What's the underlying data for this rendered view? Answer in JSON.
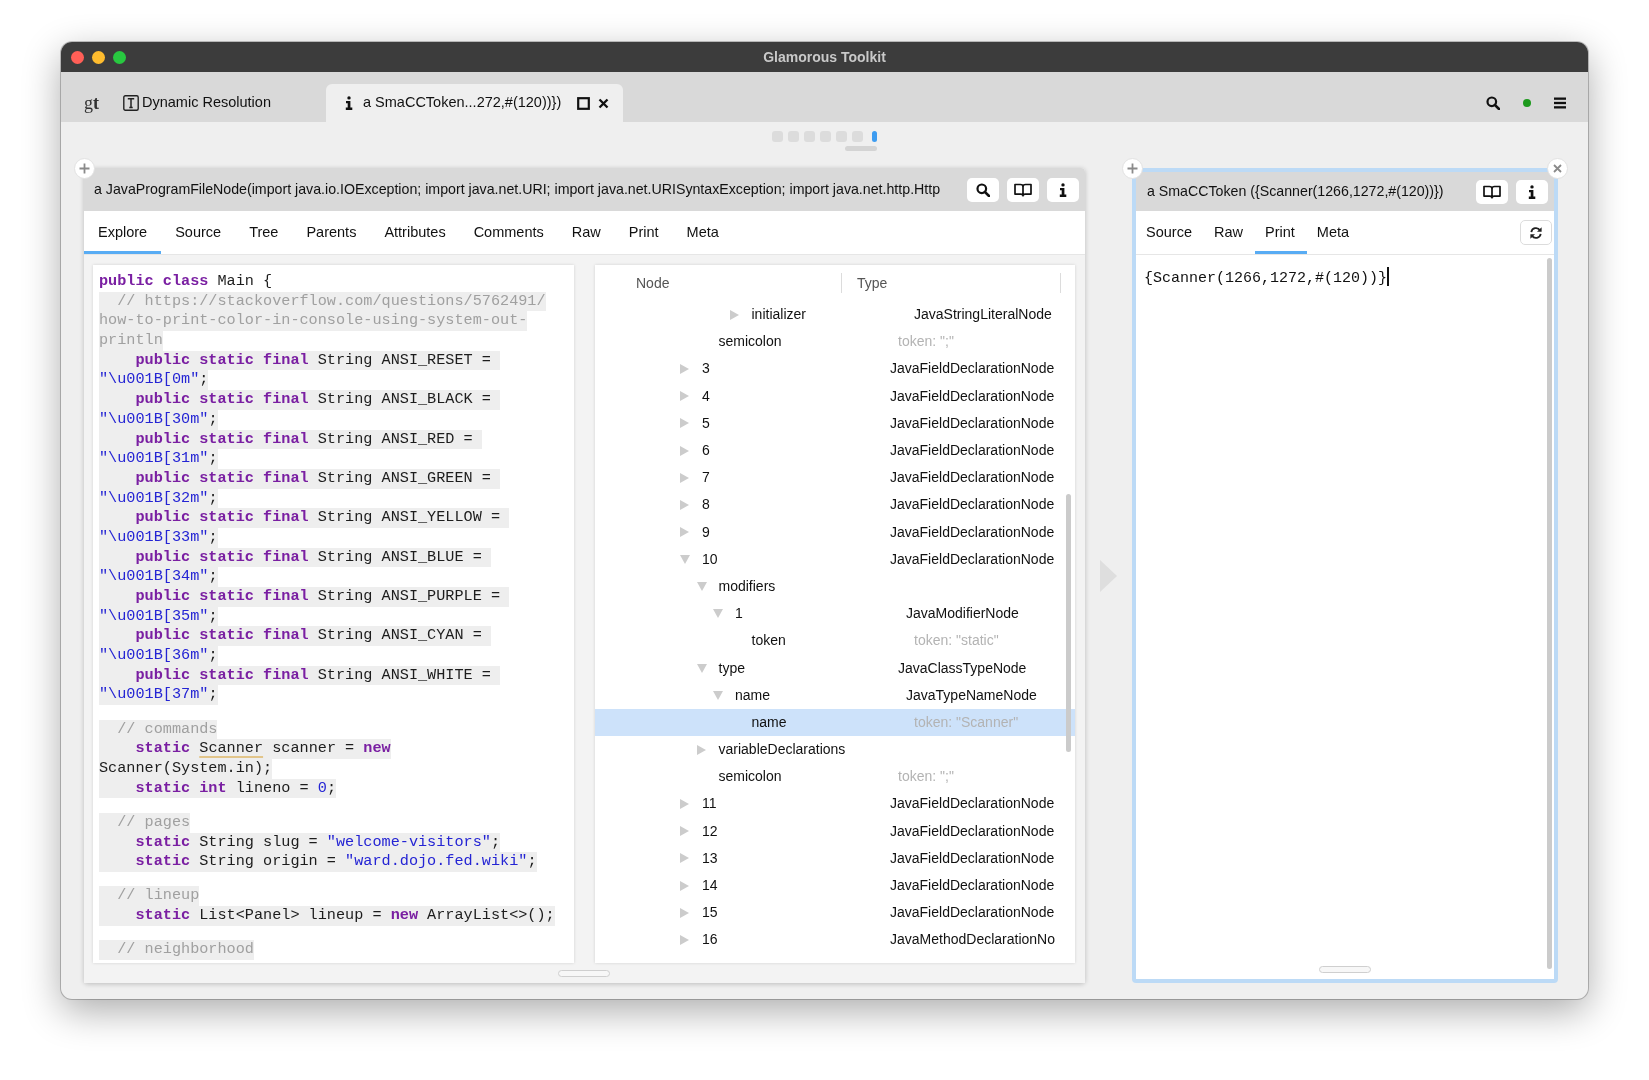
{
  "window": {
    "title": "Glamorous Toolkit"
  },
  "logo": "g**t**",
  "tabs": [
    {
      "kind": "page",
      "label": "Dynamic Resolution",
      "selected": false
    },
    {
      "kind": "inspector",
      "label": "a SmaCCToken...272,#(120))})",
      "selected": true
    }
  ],
  "pager": [
    {
      "selected": false
    },
    {
      "selected": false
    },
    {
      "selected": false
    },
    {
      "selected": false
    },
    {
      "selected": false
    },
    {
      "selected": false
    },
    {
      "selected": true
    }
  ],
  "panes": [
    {
      "kind": "explorer",
      "active": false,
      "closable": false,
      "title": "a JavaProgramFileNode(import java.io.IOException; import java.net.URI; import java.net.URISyntaxException; import java.net.http.Http",
      "actions": [
        {
          "kind": "search"
        },
        {
          "kind": "book"
        },
        {
          "kind": "info"
        }
      ],
      "views": [
        {
          "label": "Explore",
          "selected": true
        },
        {
          "label": "Source",
          "selected": false
        },
        {
          "label": "Tree",
          "selected": false
        },
        {
          "label": "Parents",
          "selected": false
        },
        {
          "label": "Attributes",
          "selected": false
        },
        {
          "label": "Comments",
          "selected": false
        },
        {
          "label": "Raw",
          "selected": false
        },
        {
          "label": "Print",
          "selected": false
        },
        {
          "label": "Meta",
          "selected": false
        }
      ],
      "code": {
        "blocks": [
          {
            "lines": [
              {
                "highlighted": false,
                "segments": [
                  {
                    "kind": "keyword",
                    "text": "public class"
                  },
                  {
                    "kind": "plain",
                    "text": " Main {"
                  }
                ]
              },
              {
                "highlighted": true,
                "segments": [
                  {
                    "kind": "comment",
                    "text": "  // https://stackoverflow.com/questions/5762491/"
                  }
                ]
              },
              {
                "highlighted": true,
                "segments": [
                  {
                    "kind": "comment",
                    "text": "how-to-print-color-in-console-using-system-out-"
                  }
                ]
              },
              {
                "highlighted": true,
                "segments": [
                  {
                    "kind": "comment",
                    "text": "println"
                  }
                ]
              },
              {
                "highlighted": true,
                "segments": [
                  {
                    "kind": "keyword",
                    "text": "    public static final"
                  },
                  {
                    "kind": "plain",
                    "text": " String ANSI_RESET = "
                  }
                ]
              },
              {
                "highlighted": true,
                "segments": [
                  {
                    "kind": "literal",
                    "text": "\"\\u001B[0m\""
                  },
                  {
                    "kind": "plain",
                    "text": ";"
                  }
                ]
              },
              {
                "highlighted": true,
                "segments": [
                  {
                    "kind": "keyword",
                    "text": "    public static final"
                  },
                  {
                    "kind": "plain",
                    "text": " String ANSI_BLACK = "
                  }
                ]
              },
              {
                "highlighted": true,
                "segments": [
                  {
                    "kind": "literal",
                    "text": "\"\\u001B[30m\""
                  },
                  {
                    "kind": "plain",
                    "text": ";"
                  }
                ]
              },
              {
                "highlighted": true,
                "segments": [
                  {
                    "kind": "keyword",
                    "text": "    public static final"
                  },
                  {
                    "kind": "plain",
                    "text": " String ANSI_RED = "
                  }
                ]
              },
              {
                "highlighted": true,
                "segments": [
                  {
                    "kind": "literal",
                    "text": "\"\\u001B[31m\""
                  },
                  {
                    "kind": "plain",
                    "text": ";"
                  }
                ]
              },
              {
                "highlighted": true,
                "segments": [
                  {
                    "kind": "keyword",
                    "text": "    public static final"
                  },
                  {
                    "kind": "plain",
                    "text": " String ANSI_GREEN = "
                  }
                ]
              },
              {
                "highlighted": true,
                "segments": [
                  {
                    "kind": "literal",
                    "text": "\"\\u001B[32m\""
                  },
                  {
                    "kind": "plain",
                    "text": ";"
                  }
                ]
              },
              {
                "highlighted": true,
                "segments": [
                  {
                    "kind": "keyword",
                    "text": "    public static final"
                  },
                  {
                    "kind": "plain",
                    "text": " String ANSI_YELLOW = "
                  }
                ]
              },
              {
                "highlighted": true,
                "segments": [
                  {
                    "kind": "literal",
                    "text": "\"\\u001B[33m\""
                  },
                  {
                    "kind": "plain",
                    "text": ";"
                  }
                ]
              },
              {
                "highlighted": true,
                "segments": [
                  {
                    "kind": "keyword",
                    "text": "    public static final"
                  },
                  {
                    "kind": "plain",
                    "text": " String ANSI_BLUE = "
                  }
                ]
              },
              {
                "highlighted": true,
                "segments": [
                  {
                    "kind": "literal",
                    "text": "\"\\u001B[34m\""
                  },
                  {
                    "kind": "plain",
                    "text": ";"
                  }
                ]
              },
              {
                "highlighted": true,
                "segments": [
                  {
                    "kind": "keyword",
                    "text": "    public static final"
                  },
                  {
                    "kind": "plain",
                    "text": " String ANSI_PURPLE = "
                  }
                ]
              },
              {
                "highlighted": true,
                "segments": [
                  {
                    "kind": "literal",
                    "text": "\"\\u001B[35m\""
                  },
                  {
                    "kind": "plain",
                    "text": ";"
                  }
                ]
              },
              {
                "highlighted": true,
                "segments": [
                  {
                    "kind": "keyword",
                    "text": "    public static final"
                  },
                  {
                    "kind": "plain",
                    "text": " String ANSI_CYAN = "
                  }
                ]
              },
              {
                "highlighted": true,
                "segments": [
                  {
                    "kind": "literal",
                    "text": "\"\\u001B[36m\""
                  },
                  {
                    "kind": "plain",
                    "text": ";"
                  }
                ]
              },
              {
                "highlighted": true,
                "segments": [
                  {
                    "kind": "keyword",
                    "text": "    public static final"
                  },
                  {
                    "kind": "plain",
                    "text": " String ANSI_WHITE = "
                  }
                ]
              },
              {
                "highlighted": true,
                "segments": [
                  {
                    "kind": "literal",
                    "text": "\"\\u001B[37m\""
                  },
                  {
                    "kind": "plain",
                    "text": ";"
                  }
                ]
              }
            ]
          },
          {
            "lines": [
              {
                "highlighted": true,
                "segments": [
                  {
                    "kind": "comment",
                    "text": "  // commands"
                  }
                ]
              },
              {
                "highlighted": true,
                "segments": [
                  {
                    "kind": "keyword",
                    "text": "    static "
                  },
                  {
                    "kind": "marked",
                    "text": "Scanner"
                  },
                  {
                    "kind": "plain",
                    "text": " scanner = "
                  },
                  {
                    "kind": "keyword",
                    "text": "new"
                  }
                ]
              },
              {
                "highlighted": true,
                "segments": [
                  {
                    "kind": "plain",
                    "text": "Scanner(System.in);"
                  }
                ]
              },
              {
                "highlighted": true,
                "segments": [
                  {
                    "kind": "keyword",
                    "text": "    static int"
                  },
                  {
                    "kind": "plain",
                    "text": " lineno = "
                  },
                  {
                    "kind": "literal",
                    "text": "0"
                  },
                  {
                    "kind": "plain",
                    "text": ";"
                  }
                ]
              }
            ]
          },
          {
            "lines": [
              {
                "highlighted": true,
                "segments": [
                  {
                    "kind": "comment",
                    "text": "  // pages"
                  }
                ]
              },
              {
                "highlighted": true,
                "segments": [
                  {
                    "kind": "keyword",
                    "text": "    static"
                  },
                  {
                    "kind": "plain",
                    "text": " String slug = "
                  },
                  {
                    "kind": "literal",
                    "text": "\"welcome-visitors\""
                  },
                  {
                    "kind": "plain",
                    "text": ";"
                  }
                ]
              },
              {
                "highlighted": true,
                "segments": [
                  {
                    "kind": "keyword",
                    "text": "    static"
                  },
                  {
                    "kind": "plain",
                    "text": " String origin = "
                  },
                  {
                    "kind": "literal",
                    "text": "\"ward.dojo.fed.wiki\""
                  },
                  {
                    "kind": "plain",
                    "text": ";"
                  }
                ]
              }
            ]
          },
          {
            "lines": [
              {
                "highlighted": true,
                "segments": [
                  {
                    "kind": "comment",
                    "text": "  // lineup"
                  }
                ]
              },
              {
                "highlighted": true,
                "segments": [
                  {
                    "kind": "keyword",
                    "text": "    static"
                  },
                  {
                    "kind": "plain",
                    "text": " List<Panel> lineup = "
                  },
                  {
                    "kind": "keyword",
                    "text": "new"
                  },
                  {
                    "kind": "plain",
                    "text": " ArrayList<>();"
                  }
                ]
              }
            ]
          },
          {
            "lines": [
              {
                "highlighted": true,
                "segments": [
                  {
                    "kind": "comment",
                    "text": "  // neighborhood"
                  }
                ]
              }
            ]
          }
        ]
      },
      "tree": {
        "columns": [
          "Node",
          "Type"
        ],
        "rows": [
          {
            "kind": "offscreen",
            "children": [
              {
                "kind": "offscreen",
                "children": [
                  {
                    "kind": "offscreen",
                    "children": [
                      {
                        "kind": "node",
                        "label": "initializer",
                        "type": "JavaStringLiteralNode",
                        "expanded": false,
                        "selected": false
                      }
                    ]
                  }
                ]
              },
              {
                "kind": "token",
                "label": "semicolon",
                "type": "token: \";\"",
                "selected": false
              }
            ]
          },
          {
            "kind": "node",
            "label": "3",
            "type": "JavaFieldDeclarationNode",
            "expanded": false,
            "selected": false
          },
          {
            "kind": "node",
            "label": "4",
            "type": "JavaFieldDeclarationNode",
            "expanded": false,
            "selected": false
          },
          {
            "kind": "node",
            "label": "5",
            "type": "JavaFieldDeclarationNode",
            "expanded": false,
            "selected": false
          },
          {
            "kind": "node",
            "label": "6",
            "type": "JavaFieldDeclarationNode",
            "expanded": false,
            "selected": false
          },
          {
            "kind": "node",
            "label": "7",
            "type": "JavaFieldDeclarationNode",
            "expanded": false,
            "selected": false
          },
          {
            "kind": "node",
            "label": "8",
            "type": "JavaFieldDeclarationNode",
            "expanded": false,
            "selected": false
          },
          {
            "kind": "node",
            "label": "9",
            "type": "JavaFieldDeclarationNode",
            "expanded": false,
            "selected": false
          },
          {
            "kind": "node",
            "label": "10",
            "type": "JavaFieldDeclarationNode",
            "expanded": true,
            "selected": false,
            "children": [
              {
                "kind": "list",
                "label": "modifiers",
                "expanded": true,
                "selected": false,
                "children": [
                  {
                    "kind": "node",
                    "label": "1",
                    "type": "JavaModifierNode",
                    "expanded": true,
                    "selected": false,
                    "children": [
                      {
                        "kind": "token",
                        "label": "token",
                        "type": "token: \"static\"",
                        "selected": false
                      }
                    ]
                  }
                ]
              },
              {
                "kind": "node",
                "label": "type",
                "type": "JavaClassTypeNode",
                "expanded": true,
                "selected": false,
                "children": [
                  {
                    "kind": "node",
                    "label": "name",
                    "type": "JavaTypeNameNode",
                    "expanded": true,
                    "selected": false,
                    "children": [
                      {
                        "kind": "token",
                        "label": "name",
                        "type": "token: \"Scanner\"",
                        "selected": true
                      }
                    ]
                  }
                ]
              },
              {
                "kind": "list",
                "label": "variableDeclarations",
                "expanded": false,
                "selected": false
              },
              {
                "kind": "token",
                "label": "semicolon",
                "type": "token: \";\"",
                "selected": false
              }
            ]
          },
          {
            "kind": "node",
            "label": "11",
            "type": "JavaFieldDeclarationNode",
            "expanded": false,
            "selected": false
          },
          {
            "kind": "node",
            "label": "12",
            "type": "JavaFieldDeclarationNode",
            "expanded": false,
            "selected": false
          },
          {
            "kind": "node",
            "label": "13",
            "type": "JavaFieldDeclarationNode",
            "expanded": false,
            "selected": false
          },
          {
            "kind": "node",
            "label": "14",
            "type": "JavaFieldDeclarationNode",
            "expanded": false,
            "selected": false
          },
          {
            "kind": "node",
            "label": "15",
            "type": "JavaFieldDeclarationNode",
            "expanded": false,
            "selected": false
          },
          {
            "kind": "node",
            "label": "16",
            "type": "JavaMethodDeclarationNo",
            "expanded": false,
            "selected": false
          }
        ]
      }
    },
    {
      "kind": "printer",
      "active": true,
      "closable": true,
      "title": "a SmaCCToken ({Scanner(1266,1272,#(120))})",
      "actions": [
        {
          "kind": "book"
        },
        {
          "kind": "info"
        }
      ],
      "views": [
        {
          "label": "Source",
          "selected": false
        },
        {
          "label": "Raw",
          "selected": false
        },
        {
          "label": "Print",
          "selected": true
        },
        {
          "label": "Meta",
          "selected": false
        }
      ],
      "view_actions": [
        {
          "kind": "refresh"
        }
      ],
      "output": {
        "text": "{Scanner(1266,1272,#(120))}",
        "focused": true
      }
    }
  ]
}
